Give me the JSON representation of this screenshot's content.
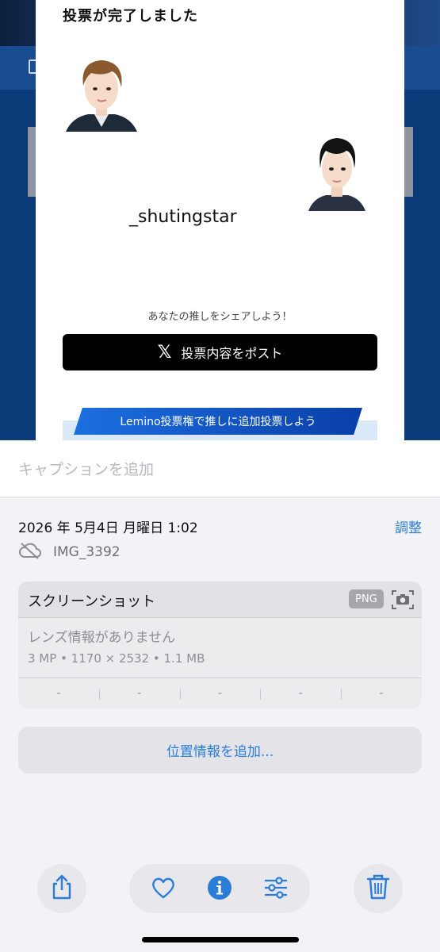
{
  "photo": {
    "modal_title": "投票が完了しました",
    "username": "_shutingstar",
    "share_hint": "あなたの推しをシェアしよう！",
    "post_button_icon": "x-logo-icon",
    "post_button_x": "𝕏",
    "post_button_label": "投票内容をポスト",
    "lemino_banner": "Lemino投票権で推しに追加投票しよう"
  },
  "caption": {
    "placeholder": "キャプションを追加"
  },
  "info": {
    "datetime": "2026 年 5月4日 月曜日 1:02",
    "adjust_label": "調整",
    "file_name": "IMG_3392",
    "card": {
      "title": "スクリーンショット",
      "format_badge": "PNG",
      "lens": "レンズ情報がありません",
      "specs": "3 MP • 1170 × 2532 • 1.1 MB",
      "exif": [
        "-",
        "-",
        "-",
        "-",
        "-"
      ]
    },
    "location_button": "位置情報を追加..."
  },
  "colors": {
    "accent": "#2a7dd6",
    "photo_bg": "#0b3a78"
  },
  "toolbar": {
    "icons": [
      "share-icon",
      "heart-icon",
      "info-icon",
      "adjust-icon",
      "trash-icon"
    ]
  }
}
